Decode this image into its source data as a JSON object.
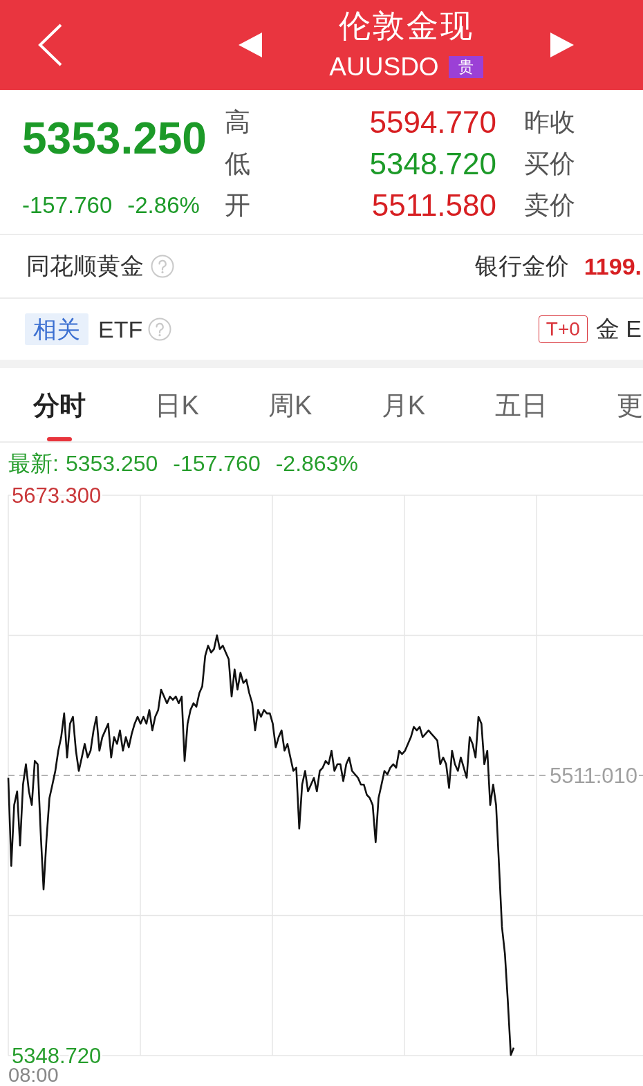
{
  "header": {
    "title": "伦敦金现",
    "symbol": "AUUSDO",
    "badge": "贵"
  },
  "quote": {
    "price": "5353.250",
    "change": "-157.760",
    "percent": "-2.86%",
    "color": "#1c9a28",
    "labels": [
      "高",
      "低",
      "开"
    ],
    "stats": [
      {
        "value": "5594.770",
        "label": "昨收",
        "color": "#d71f22"
      },
      {
        "value": "5348.720",
        "label": "买价",
        "color": "#1c9a28"
      },
      {
        "value": "5511.580",
        "label": "卖价",
        "color": "#d71f22"
      }
    ]
  },
  "gold_row": {
    "title": "同花顺黄金",
    "right_label": "银行金价",
    "right_value": "1199."
  },
  "etf_row": {
    "tag": "相关",
    "title": "ETF",
    "badge": "T+0",
    "right_text": "金 E"
  },
  "tabs": [
    {
      "label": "分时",
      "selected": true
    },
    {
      "label": "日K",
      "selected": false
    },
    {
      "label": "周K",
      "selected": false
    },
    {
      "label": "月K",
      "selected": false
    },
    {
      "label": "五日",
      "selected": false
    },
    {
      "label": "更",
      "selected": false
    }
  ],
  "chart": {
    "legend": {
      "label": "最新:",
      "price": "5353.250",
      "change": "-157.760",
      "percent": "-2.863%"
    },
    "chart_data": {
      "type": "line",
      "ylim": [
        5348.72,
        5673.3
      ],
      "yticks": [
        {
          "value": 5673.3,
          "label": "5673.300"
        },
        {
          "value": 5348.72,
          "label": "5348.720"
        }
      ],
      "ref_lines": [
        {
          "axis": "y",
          "value": 5511.01,
          "label": "5511.010"
        }
      ],
      "values": [
        5509.6,
        5458.6,
        5493.9,
        5501.8,
        5470.4,
        5505.7,
        5517.5,
        5501.8,
        5493.9,
        5519.4,
        5517.5,
        5478.2,
        5444.9,
        5474.3,
        5497.9,
        5505.7,
        5513.6,
        5525.3,
        5533.2,
        5546.9,
        5521.4,
        5541.0,
        5545.0,
        5525.3,
        5513.6,
        5521.4,
        5529.3,
        5521.4,
        5525.3,
        5537.1,
        5545.0,
        5525.3,
        5533.2,
        5537.1,
        5541.0,
        5521.4,
        5533.2,
        5529.3,
        5537.1,
        5525.3,
        5533.2,
        5527.3,
        5535.1,
        5541.0,
        5545.0,
        5541.0,
        5545.0,
        5541.0,
        5548.9,
        5537.1,
        5545.0,
        5548.9,
        5560.7,
        5556.7,
        5552.8,
        5556.7,
        5554.8,
        5556.7,
        5552.8,
        5556.7,
        5519.4,
        5541.0,
        5548.9,
        5552.8,
        5550.8,
        5558.7,
        5562.6,
        5580.3,
        5586.2,
        5582.2,
        5584.2,
        5592.1,
        5584.2,
        5586.2,
        5582.2,
        5578.3,
        5556.7,
        5572.4,
        5560.7,
        5570.5,
        5564.6,
        5566.5,
        5558.7,
        5552.8,
        5537.1,
        5548.9,
        5545.0,
        5548.9,
        5546.9,
        5546.9,
        5541.0,
        5527.3,
        5533.2,
        5537.1,
        5525.3,
        5529.3,
        5521.4,
        5513.6,
        5515.5,
        5480.2,
        5505.7,
        5513.6,
        5501.8,
        5505.7,
        5509.6,
        5501.8,
        5513.6,
        5515.5,
        5519.4,
        5517.5,
        5525.3,
        5513.6,
        5517.5,
        5517.5,
        5507.7,
        5517.5,
        5521.4,
        5513.6,
        5511.6,
        5509.6,
        5505.7,
        5505.7,
        5499.8,
        5497.9,
        5493.9,
        5472.3,
        5497.9,
        5505.7,
        5513.6,
        5511.6,
        5515.5,
        5517.5,
        5515.5,
        5525.3,
        5523.4,
        5525.3,
        5529.3,
        5533.2,
        5539.1,
        5537.1,
        5539.1,
        5533.2,
        5535.1,
        5537.1,
        5535.1,
        5533.2,
        5531.2,
        5517.5,
        5521.4,
        5517.5,
        5503.7,
        5525.3,
        5517.5,
        5513.6,
        5521.4,
        5515.5,
        5509.6,
        5533.2,
        5529.3,
        5521.4,
        5545.0,
        5541.0,
        5517.5,
        5525.3,
        5493.9,
        5505.7,
        5493.9,
        5458.6,
        5423.3,
        5407.6,
        5380.1,
        5349.0,
        5353.3,
        null,
        null,
        null,
        null,
        null,
        null,
        null,
        null,
        null,
        null,
        null,
        null,
        null,
        null,
        null,
        null,
        null,
        null,
        null,
        null,
        null,
        null,
        null,
        null,
        null,
        null,
        null,
        null,
        null,
        null,
        null,
        null,
        null,
        null,
        null,
        null,
        null,
        null,
        null,
        null,
        null,
        null,
        null,
        null
      ]
    },
    "time_label": "08:00"
  }
}
